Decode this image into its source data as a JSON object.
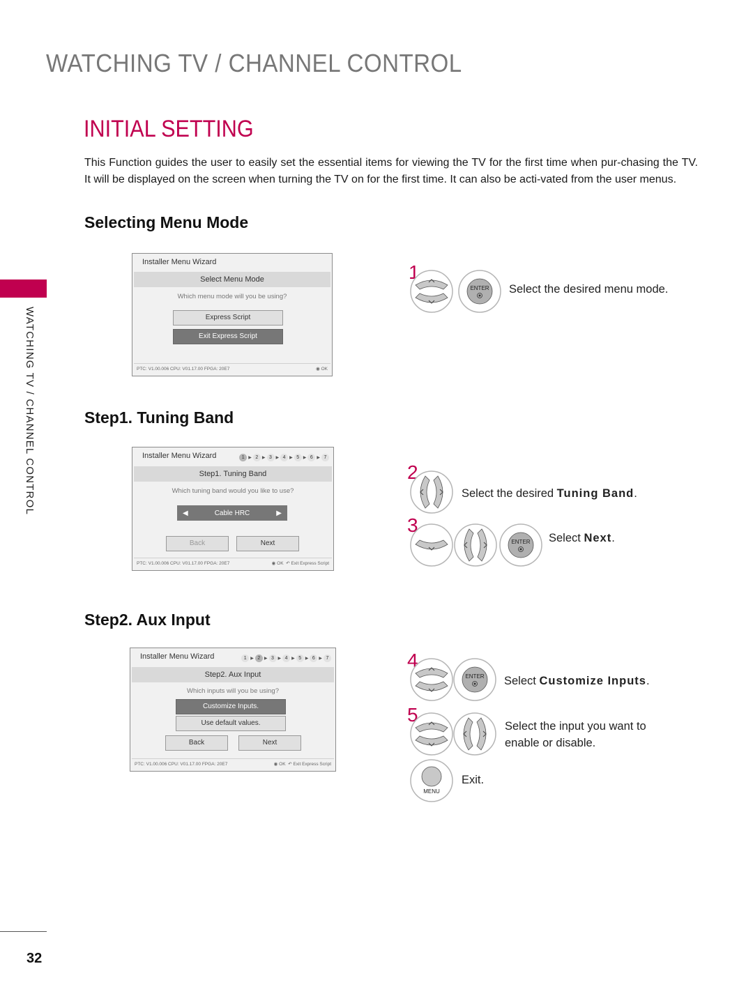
{
  "header": {
    "chapter_title": "WATCHING TV / CHANNEL CONTROL",
    "section_title": "INITIAL SETTING",
    "side_label": "WATCHING TV / CHANNEL CONTROL",
    "page_number": "32",
    "accent_color": "#c0004f"
  },
  "intro": "This Function guides the user to easily set the essential items for viewing the TV for the first time when pur-chasing the TV. It will be displayed on the screen when turning the TV on for the first time. It can also be acti-vated from the user menus.",
  "sections": [
    {
      "title": "Selecting Menu Mode",
      "osd": {
        "title": "Installer Menu Wizard",
        "band": "Select Menu Mode",
        "question": "Which menu mode will you be using?",
        "options": [
          "Express Script",
          "Exit Express Script"
        ],
        "selected_option": "Exit Express Script",
        "footer_version": "PTC:  V1.00.006 CPU: V01.17.00 FPGA: 20E7",
        "footer_ok": "OK"
      },
      "instructions": [
        {
          "num": "1",
          "buttons": [
            "up-down-icon",
            "enter-icon"
          ],
          "text": "Select the desired menu mode."
        }
      ]
    },
    {
      "title": "Step1. Tuning Band",
      "osd": {
        "title": "Installer Menu Wizard",
        "steps": [
          "1",
          "2",
          "3",
          "4",
          "5",
          "6",
          "7"
        ],
        "active_step": "1",
        "band": "Step1. Tuning Band",
        "question": "Which tuning band would you like to use?",
        "selector_value": "Cable HRC",
        "back_label": "Back",
        "next_label": "Next",
        "footer_version": "PTC:  V1.00.006 CPU: V01.17.00 FPGA: 20E7",
        "footer_ok": "OK",
        "footer_exit": "Exit Express Script"
      },
      "instructions": [
        {
          "num": "2",
          "buttons": [
            "left-right-icon"
          ],
          "text_prefix": "Select the desired ",
          "text_bold": "Tuning Band",
          "text_suffix": "."
        },
        {
          "num": "3",
          "buttons": [
            "down-icon",
            "left-right-icon",
            "enter-icon"
          ],
          "text_prefix": "Select ",
          "text_bold": "Next",
          "text_suffix": "."
        }
      ]
    },
    {
      "title": "Step2. Aux Input",
      "osd": {
        "title": "Installer Menu Wizard",
        "steps": [
          "1",
          "2",
          "3",
          "4",
          "5",
          "6",
          "7"
        ],
        "active_step": "2",
        "band": "Step2. Aux Input",
        "question": "Which inputs will you be using?",
        "options": [
          "Customize Inputs.",
          "Use default values."
        ],
        "selected_option": "Customize Inputs.",
        "back_label": "Back",
        "next_label": "Next",
        "footer_version": "PTC:  V1.00.006 CPU: V01.17.00 FPGA: 20E7",
        "footer_ok": "OK",
        "footer_exit": "Exit Express Script"
      },
      "instructions": [
        {
          "num": "4",
          "buttons": [
            "up-down-icon",
            "enter-icon"
          ],
          "text_prefix": "Select ",
          "text_bold": "Customize Inputs",
          "text_suffix": "."
        },
        {
          "num": "5",
          "buttons": [
            "up-down-icon",
            "left-right-icon"
          ],
          "text": "Select the input you want to enable or disable."
        },
        {
          "num": "",
          "buttons": [
            "menu-icon"
          ],
          "text": "Exit."
        }
      ]
    }
  ],
  "button_labels": {
    "enter": "ENTER",
    "menu": "MENU"
  }
}
